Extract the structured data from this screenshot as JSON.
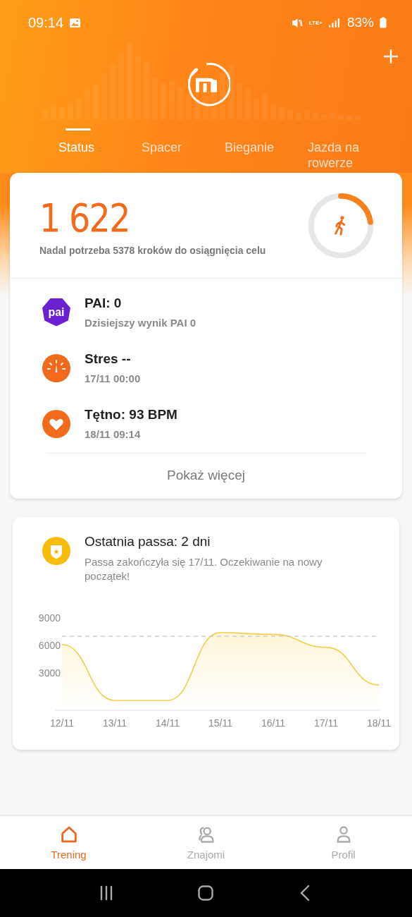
{
  "status_bar": {
    "time": "09:14",
    "network": "LTE+",
    "battery": "83%"
  },
  "header": {
    "tabs": [
      {
        "label": "Status",
        "selected": true
      },
      {
        "label": "Spacer",
        "selected": false
      },
      {
        "label": "Bieganie",
        "selected": false
      },
      {
        "label": "Jazda na rowerze",
        "selected": false
      }
    ]
  },
  "steps_card": {
    "steps": "1 622",
    "remaining": "Nadal potrzeba 5378 kroków do osiągnięcia celu",
    "level": 0.23,
    "metrics": [
      {
        "kind": "pai",
        "icon_text": "pai",
        "title": "PAI: 0",
        "subtitle": "Dzisiejszy wynik PAI 0"
      },
      {
        "kind": "stress",
        "title": "Stres --",
        "subtitle": "17/11 00:00"
      },
      {
        "kind": "heart",
        "title": "Tętno: 93 BPM",
        "subtitle": "18/11 09:14"
      }
    ],
    "more_link": "Pokaż więcej"
  },
  "streak_card": {
    "title": "Ostatnia passa: 2 dni",
    "subtitle": "Passa zakończyła się 17/11. Oczekiwanie na nowy początek!",
    "chart_data": {
      "type": "area",
      "categories": [
        "12/11",
        "13/11",
        "14/11",
        "15/11",
        "16/11",
        "17/11",
        "18/11"
      ],
      "series": [
        {
          "color": "#f2cf4a",
          "values": [
            6100,
            0,
            0,
            7400,
            7200,
            5800,
            1700
          ]
        }
      ],
      "ylim": [
        0,
        9000
      ],
      "yticks": [
        3000,
        6000,
        9000
      ],
      "ref_lines": [
        {
          "axis": "y",
          "value": 7000
        }
      ]
    }
  },
  "bottom_nav": [
    {
      "label": "Trening",
      "selected": true
    },
    {
      "label": "Znajomi",
      "selected": false
    },
    {
      "label": "Profil",
      "selected": false
    }
  ]
}
